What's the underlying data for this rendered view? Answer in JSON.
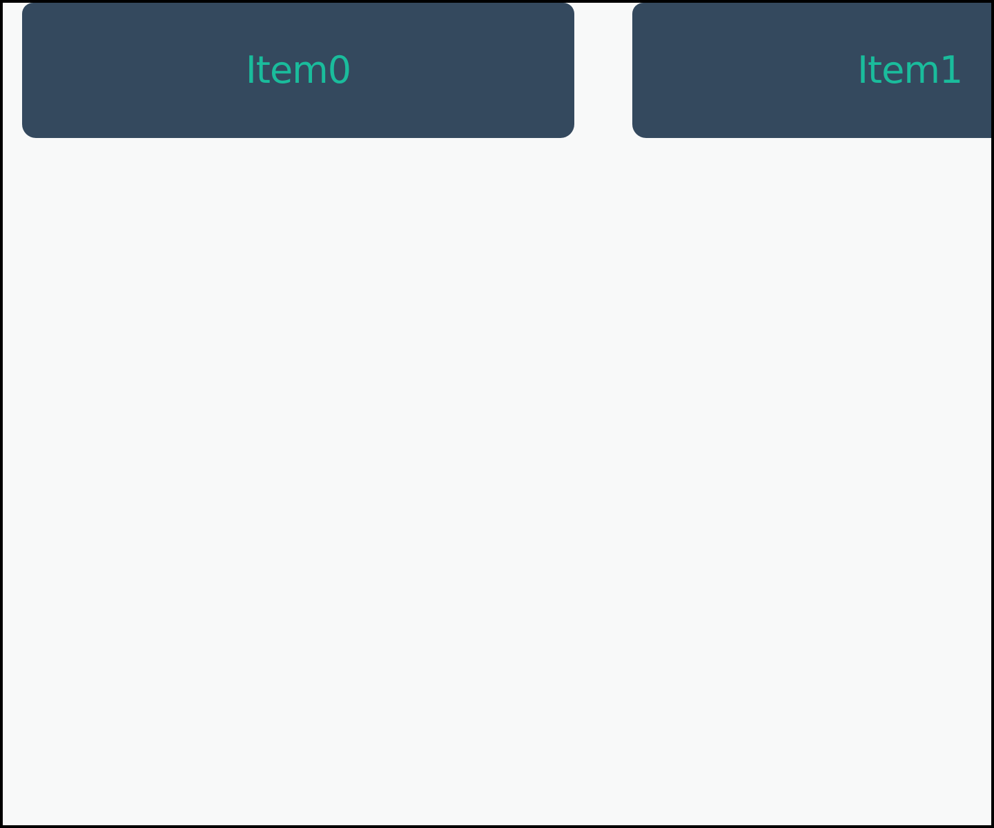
{
  "colors": {
    "background": "#f8f9f9",
    "card_background": "#34495e",
    "card_text": "#1abc9c",
    "frame_border": "#000000"
  },
  "carousel": {
    "items": [
      {
        "label": "Item0"
      },
      {
        "label": "Item1"
      }
    ]
  }
}
